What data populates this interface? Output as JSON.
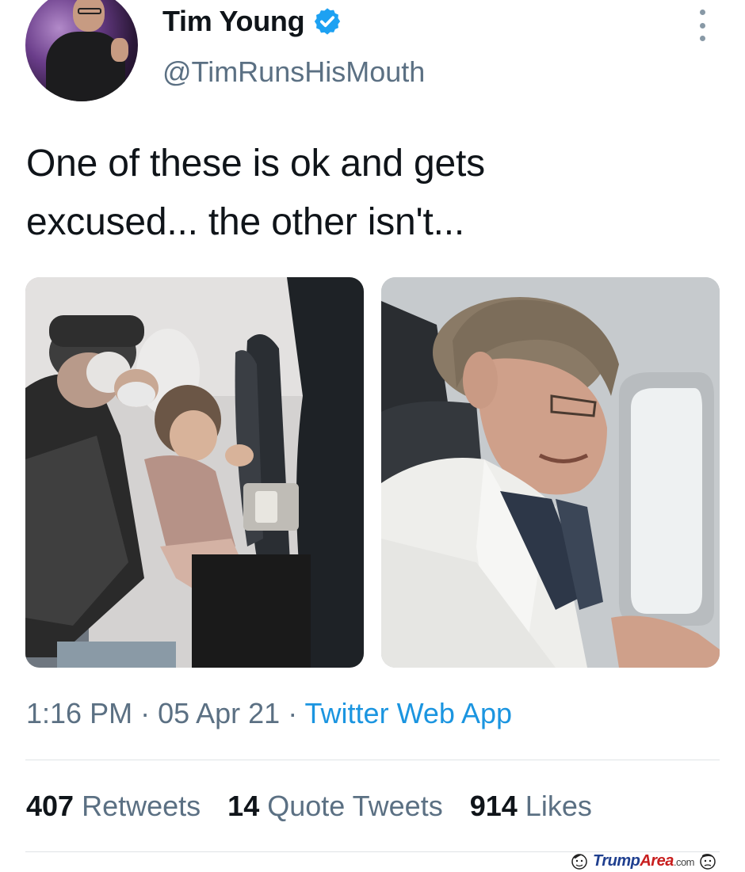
{
  "author": {
    "name": "Tim Young",
    "handle": "@TimRunsHisMouth",
    "verified": true,
    "avatar_icon": "profile-photo"
  },
  "tweet": {
    "text_line1": "One of these is ok and gets",
    "text_line2": "excused... the other isn't...",
    "images": [
      "airplane-toddler-photo",
      "airplane-passenger-photo"
    ]
  },
  "meta": {
    "time": "1:16 PM",
    "separator1": " · ",
    "date": "05 Apr 21",
    "separator2": " · ",
    "source": "Twitter Web App"
  },
  "stats": {
    "retweets_count": "407",
    "retweets_label": "Retweets",
    "quotes_count": "14",
    "quotes_label": "Quote Tweets",
    "likes_count": "914",
    "likes_label": "Likes"
  },
  "watermark": {
    "part1": "Trump",
    "part2": "Area",
    "part3": ".com"
  },
  "colors": {
    "link": "#1b95e0",
    "secondary_text": "#5b7083",
    "verified": "#1da1f2",
    "divider": "#dfe3e6"
  }
}
